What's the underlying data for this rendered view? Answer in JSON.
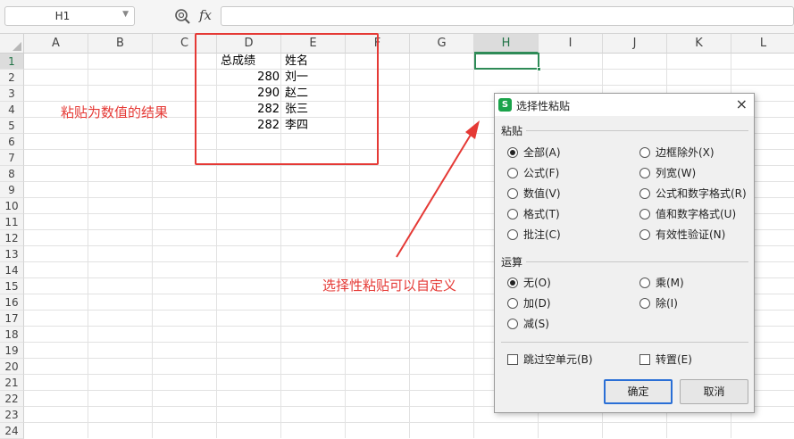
{
  "formula_bar": {
    "name_box": "H1",
    "fx_label": "fx",
    "formula": ""
  },
  "columns": [
    "A",
    "B",
    "C",
    "D",
    "E",
    "F",
    "G",
    "H",
    "I",
    "J",
    "K",
    "L"
  ],
  "rows": [
    "1",
    "2",
    "3",
    "4",
    "5",
    "6",
    "7",
    "8",
    "9",
    "10",
    "11",
    "12",
    "13",
    "14",
    "15",
    "16",
    "17",
    "18",
    "19",
    "20",
    "21",
    "22",
    "23",
    "24"
  ],
  "cells": {
    "D1": "总成绩",
    "E1": "姓名",
    "D2": "280",
    "E2": "刘一",
    "D3": "290",
    "E3": "赵二",
    "D4": "282",
    "E4": "张三",
    "D5": "282",
    "E5": "李四"
  },
  "annotations": {
    "left_note": "粘贴为数值的结果",
    "arrow_note": "选择性粘贴可以自定义"
  },
  "accent_colors": {
    "annotation": "#e53935",
    "selection": "#2e8b57",
    "dialog_button_focus": "#2a6fd6"
  },
  "dialog": {
    "title": "选择性粘贴",
    "logo": "S",
    "close": "×",
    "paste_section": "粘贴",
    "paste_options": [
      {
        "label": "全部(A)",
        "checked": true
      },
      {
        "label": "公式(F)",
        "checked": false
      },
      {
        "label": "数值(V)",
        "checked": false
      },
      {
        "label": "格式(T)",
        "checked": false
      },
      {
        "label": "批注(C)",
        "checked": false
      },
      {
        "label": "边框除外(X)",
        "checked": false
      },
      {
        "label": "列宽(W)",
        "checked": false
      },
      {
        "label": "公式和数字格式(R)",
        "checked": false
      },
      {
        "label": "值和数字格式(U)",
        "checked": false
      },
      {
        "label": "有效性验证(N)",
        "checked": false
      }
    ],
    "operation_section": "运算",
    "operation_options": [
      {
        "label": "无(O)",
        "checked": true
      },
      {
        "label": "加(D)",
        "checked": false
      },
      {
        "label": "减(S)",
        "checked": false
      },
      {
        "label": "乘(M)",
        "checked": false
      },
      {
        "label": "除(I)",
        "checked": false
      }
    ],
    "skip_blanks": "跳过空单元(B)",
    "transpose": "转置(E)",
    "ok": "确定",
    "cancel": "取消"
  }
}
